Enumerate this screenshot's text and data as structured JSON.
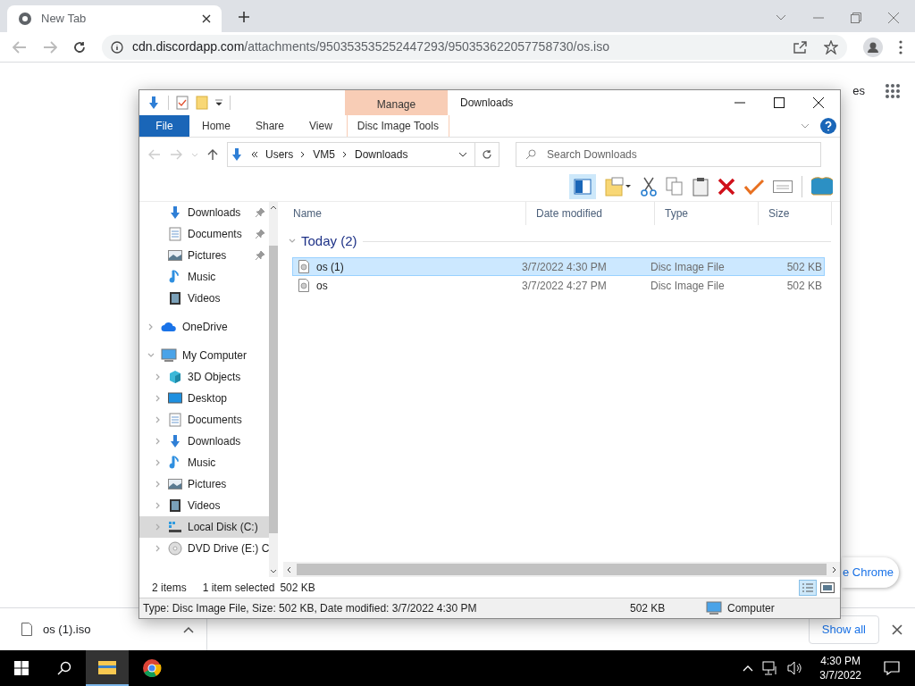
{
  "browser": {
    "tab": {
      "title": "New Tab"
    },
    "url": {
      "host": "cdn.discordapp.com",
      "path": "/attachments/950353535252447293/950353622057758730/os.iso"
    },
    "page": {
      "partial_link": "es",
      "partial_button": "e Chrome"
    }
  },
  "explorer": {
    "title": "Downloads",
    "context_group": "Manage",
    "ribbon_tabs": [
      {
        "label": "File",
        "kind": "file",
        "selected": false
      },
      {
        "label": "Home",
        "kind": "plain",
        "selected": false
      },
      {
        "label": "Share",
        "kind": "plain",
        "selected": false
      },
      {
        "label": "View",
        "kind": "plain",
        "selected": false
      },
      {
        "label": "Disc Image Tools",
        "kind": "context",
        "selected": false
      }
    ],
    "breadcrumbs": [
      "Users",
      "VM5",
      "Downloads"
    ],
    "search": {
      "placeholder": "Search Downloads"
    },
    "quick_access": [
      {
        "label": "Downloads",
        "kind": "downloads",
        "pinned": true
      },
      {
        "label": "Documents",
        "kind": "documents",
        "pinned": true
      },
      {
        "label": "Pictures",
        "kind": "pictures",
        "pinned": true
      },
      {
        "label": "Music",
        "kind": "music",
        "pinned": false
      },
      {
        "label": "Videos",
        "kind": "videos",
        "pinned": false
      }
    ],
    "tree": [
      {
        "label": "OneDrive",
        "kind": "cloud",
        "expanded": false,
        "selected": false
      },
      {
        "label": "My Computer",
        "kind": "computer",
        "expanded": true,
        "selected": false,
        "children": [
          {
            "label": "3D Objects",
            "kind": "cube",
            "expanded": false,
            "selected": false
          },
          {
            "label": "Desktop",
            "kind": "desktop",
            "expanded": false,
            "selected": false
          },
          {
            "label": "Documents",
            "kind": "documents",
            "expanded": false,
            "selected": false
          },
          {
            "label": "Downloads",
            "kind": "downloads",
            "expanded": false,
            "selected": false
          },
          {
            "label": "Music",
            "kind": "music",
            "expanded": false,
            "selected": false
          },
          {
            "label": "Pictures",
            "kind": "pictures",
            "expanded": false,
            "selected": false
          },
          {
            "label": "Videos",
            "kind": "videos",
            "expanded": false,
            "selected": false
          },
          {
            "label": "Local Disk (C:)",
            "kind": "disk",
            "expanded": false,
            "selected": true
          },
          {
            "label": "DVD Drive (E:) C",
            "kind": "dvd",
            "expanded": false,
            "selected": false
          }
        ]
      }
    ],
    "columns": [
      "Name",
      "Date modified",
      "Type",
      "Size"
    ],
    "group": {
      "label": "Today (2)",
      "expanded": true
    },
    "rows": [
      {
        "name": "os (1)",
        "date": "3/7/2022 4:30 PM",
        "type": "Disc Image File",
        "size": "502 KB",
        "selected": true
      },
      {
        "name": "os",
        "date": "3/7/2022 4:27 PM",
        "type": "Disc Image File",
        "size": "502 KB",
        "selected": false
      }
    ],
    "status": {
      "count": "2 items",
      "selection": "1 item selected",
      "size": "502 KB"
    },
    "details": {
      "text": "Type: Disc Image File, Size: 502 KB, Date modified: 3/7/2022 4:30 PM",
      "size": "502 KB",
      "location": "Computer"
    }
  },
  "download_bar": {
    "file": "os (1).iso",
    "show_all": "Show all"
  },
  "taskbar": {
    "time": "4:30 PM",
    "date": "3/7/2022"
  }
}
